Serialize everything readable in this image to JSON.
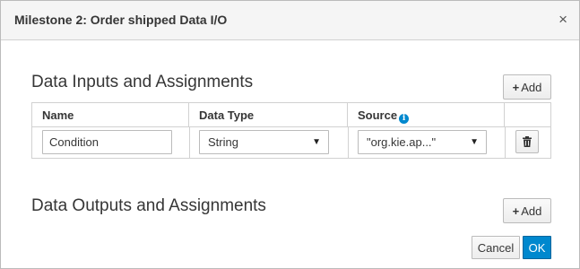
{
  "dialog": {
    "title": "Milestone 2: Order shipped Data I/O",
    "close_glyph": "×"
  },
  "inputs_section": {
    "title": "Data Inputs and Assignments",
    "add_label": "Add",
    "columns": [
      "Name",
      "Data Type",
      "Source"
    ],
    "rows": [
      {
        "name": "Condition",
        "data_type": "String",
        "source": "\"org.kie.ap...\""
      }
    ]
  },
  "outputs_section": {
    "title": "Data Outputs and Assignments",
    "add_label": "Add"
  },
  "footer": {
    "cancel_label": "Cancel",
    "ok_label": "OK"
  },
  "icons": {
    "close": "close-icon",
    "plus": "plus-icon",
    "info": "info-icon",
    "dropdown": "caret-down-icon",
    "trash": "trash-icon"
  },
  "colors": {
    "header_bg": "#f5f5f5",
    "primary": "#0088ce",
    "border": "#d1d1d1",
    "text": "#363636"
  }
}
